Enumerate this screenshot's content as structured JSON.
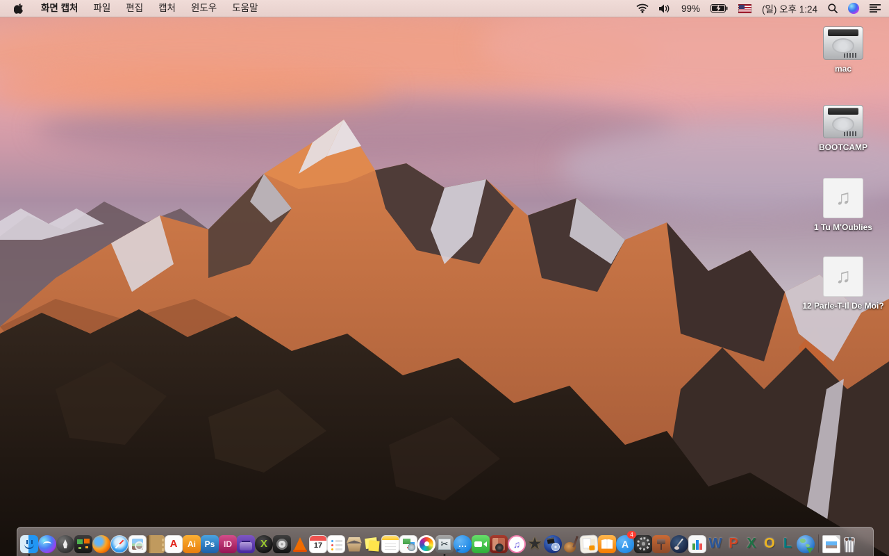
{
  "menu_bar": {
    "apple_menu_icon": "apple-logo",
    "app_name": "화면 캡처",
    "menus": [
      "파일",
      "편집",
      "캡처",
      "윈도우",
      "도움말"
    ],
    "status": {
      "wifi_icon": "wifi",
      "volume_icon": "volume-on",
      "battery_percent": "99%",
      "battery_icon": "battery-charging",
      "input_source_icon": "us-flag",
      "clock": "(일) 오후 1:24",
      "search_icon": "spotlight-search",
      "siri_icon": "siri",
      "notification_icon": "notification-center"
    }
  },
  "desktop": {
    "icons": [
      {
        "id": "mac-disk",
        "label": "mac",
        "type": "disk"
      },
      {
        "id": "bootcamp-disk",
        "label": "BOOTCAMP",
        "type": "disk"
      },
      {
        "id": "audio-file-1",
        "label": "1 Tu M'Oublies",
        "type": "audio",
        "glyph": "♫"
      },
      {
        "id": "audio-file-2",
        "label": "12 Parle-T-Il De Moi?",
        "type": "audio",
        "glyph": "♫"
      }
    ]
  },
  "dock": {
    "items": [
      {
        "id": "finder",
        "label": "Finder",
        "running": true
      },
      {
        "id": "siri",
        "label": "Siri"
      },
      {
        "id": "launchpad",
        "label": "Launchpad"
      },
      {
        "id": "mission-control",
        "label": "Mission Control"
      },
      {
        "id": "firefox",
        "label": "Firefox"
      },
      {
        "id": "safari",
        "label": "Safari"
      },
      {
        "id": "preview",
        "label": "Preview"
      },
      {
        "id": "contacts",
        "label": "Contacts"
      },
      {
        "id": "acrobat",
        "label": "Adobe Acrobat",
        "glyph": "A"
      },
      {
        "id": "illustrator",
        "label": "Adobe Illustrator",
        "glyph": "Ai"
      },
      {
        "id": "photoshop",
        "label": "Adobe Photoshop",
        "glyph": "Ps"
      },
      {
        "id": "indesign",
        "label": "Adobe InDesign",
        "glyph": "ID"
      },
      {
        "id": "toast",
        "label": "Toast Titanium"
      },
      {
        "id": "media-x",
        "label": "Media App",
        "glyph": "X"
      },
      {
        "id": "disk-tool",
        "label": "Disk Utility App"
      },
      {
        "id": "vlc",
        "label": "VLC"
      },
      {
        "id": "calendar",
        "label": "Calendar",
        "glyph": "17"
      },
      {
        "id": "reminders",
        "label": "Reminders"
      },
      {
        "id": "archive-box",
        "label": "Archive Utility"
      },
      {
        "id": "stickies",
        "label": "Stickies"
      },
      {
        "id": "notes",
        "label": "Notes"
      },
      {
        "id": "installer-doc",
        "label": "Installer"
      },
      {
        "id": "photos",
        "label": "Photos"
      },
      {
        "id": "grab",
        "label": "Grab",
        "glyph": "✂",
        "running": true
      },
      {
        "id": "messages",
        "label": "Messages",
        "glyph": "…"
      },
      {
        "id": "facetime",
        "label": "FaceTime"
      },
      {
        "id": "photo-booth",
        "label": "Photo Booth"
      },
      {
        "id": "itunes",
        "label": "iTunes",
        "glyph": "♫"
      },
      {
        "id": "imovie",
        "label": "iMovie",
        "glyph": "★"
      },
      {
        "id": "idvd",
        "label": "iDVD"
      },
      {
        "id": "garageband",
        "label": "GarageBand"
      },
      {
        "id": "collage-app",
        "label": "Collage App"
      },
      {
        "id": "ibooks",
        "label": "iBooks"
      },
      {
        "id": "app-store",
        "label": "App Store",
        "glyph": "A",
        "badge": "4"
      },
      {
        "id": "system-preferences",
        "label": "System Preferences"
      },
      {
        "id": "keynote",
        "label": "Keynote"
      },
      {
        "id": "pages",
        "label": "Pages"
      },
      {
        "id": "numbers",
        "label": "Numbers"
      },
      {
        "id": "word",
        "label": "Microsoft Word",
        "glyph": "W"
      },
      {
        "id": "powerpoint",
        "label": "Microsoft PowerPoint",
        "glyph": "P"
      },
      {
        "id": "excel",
        "label": "Microsoft Excel",
        "glyph": "X"
      },
      {
        "id": "outlook",
        "label": "Microsoft Outlook",
        "glyph": "O"
      },
      {
        "id": "lync",
        "label": "Microsoft Lync",
        "glyph": "L"
      },
      {
        "id": "web-downloader",
        "label": "Web Downloader"
      },
      {
        "id": "separator",
        "separator": true
      },
      {
        "id": "image-file",
        "label": "Image File"
      },
      {
        "id": "trash",
        "label": "Trash"
      }
    ]
  },
  "colors": {
    "menu_bar_bg": "#ecd6d2",
    "menu_text": "#1d1a1a",
    "dock_bg": "rgba(165,152,152,0.55)",
    "desktop_label": "#ffffff",
    "badge": "#ff3b30",
    "sky_top": "#e09a92",
    "sunlit_rock": "#c4663a",
    "shadow_rock": "#4a3a36",
    "foreground_rock": "#241b15",
    "snow": "#ddd9e0"
  }
}
